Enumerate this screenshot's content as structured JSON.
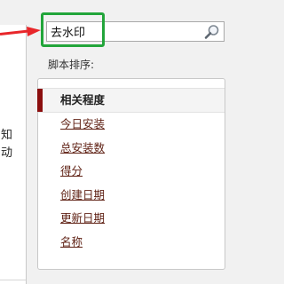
{
  "search": {
    "value": "去水印"
  },
  "sort": {
    "label": "脚本排序:",
    "items": [
      {
        "label": "相关程度",
        "active": true
      },
      {
        "label": "今日安装",
        "active": false
      },
      {
        "label": "总安装数",
        "active": false
      },
      {
        "label": "得分",
        "active": false
      },
      {
        "label": "创建日期",
        "active": false
      },
      {
        "label": "更新日期",
        "active": false
      },
      {
        "label": "名称",
        "active": false
      }
    ]
  },
  "left_panel": {
    "fragments": [
      "知",
      "动"
    ]
  },
  "colors": {
    "highlight": "#22a53a",
    "arrow": "#e8262a",
    "active_bar": "#8b0e0e",
    "link": "#5e1f12"
  },
  "icons": {
    "search": "magnifier-icon"
  }
}
